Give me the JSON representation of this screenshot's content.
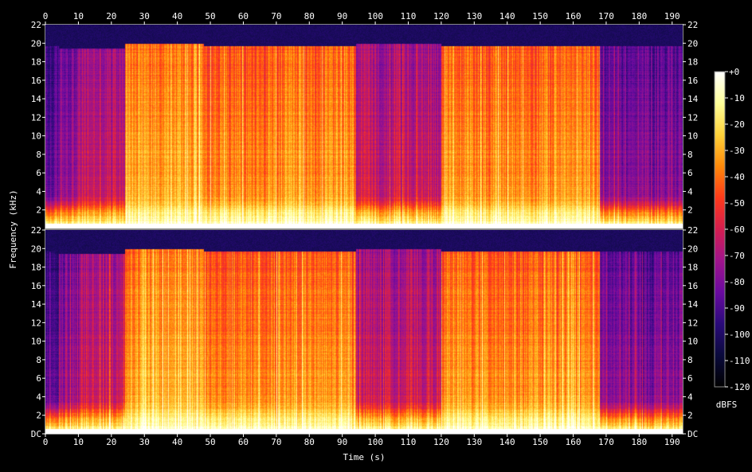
{
  "chart_data": {
    "type": "heatmap",
    "xlabel": "Time (s)",
    "ylabel": "Frequency (kHz)",
    "x_ticks": [
      0,
      10,
      20,
      30,
      40,
      50,
      60,
      70,
      80,
      90,
      100,
      110,
      120,
      130,
      140,
      150,
      160,
      170,
      180,
      190
    ],
    "xlim": [
      0,
      193.2
    ],
    "channels": [
      {
        "ylim": [
          0,
          22
        ],
        "y_ticks": [
          "2",
          "4",
          "6",
          "8",
          "10",
          "12",
          "14",
          "16",
          "18",
          "20",
          "22"
        ]
      },
      {
        "ylim": [
          0,
          22
        ],
        "y_ticks": [
          "DC",
          "2",
          "4",
          "6",
          "8",
          "10",
          "12",
          "14",
          "16",
          "18",
          "20",
          "22"
        ]
      }
    ],
    "colorbar": {
      "label": "dBFS",
      "range": [
        -120,
        0
      ],
      "ticks": [
        "+0",
        "-10",
        "-20",
        "-30",
        "-40",
        "-50",
        "-60",
        "-70",
        "-80",
        "-90",
        "-100",
        "-110",
        "-120"
      ],
      "colors": [
        "#000000",
        "#0a0a3c",
        "#2a0a7a",
        "#6a0aa0",
        "#a0148c",
        "#d41e50",
        "#ff3a1a",
        "#ff8a0a",
        "#ffd23a",
        "#ffff9a",
        "#ffffff"
      ]
    },
    "segments": [
      {
        "t": [
          0,
          4
        ],
        "intensity": 0.32,
        "cutoff_khz": 19.7
      },
      {
        "t": [
          4,
          10
        ],
        "intensity": 0.42,
        "cutoff_khz": 19.5
      },
      {
        "t": [
          10,
          24
        ],
        "intensity": 0.5,
        "cutoff_khz": 19.5
      },
      {
        "t": [
          24,
          48
        ],
        "intensity": 0.78,
        "cutoff_khz": 20.0
      },
      {
        "t": [
          48,
          70
        ],
        "intensity": 0.72,
        "cutoff_khz": 19.7
      },
      {
        "t": [
          70,
          94
        ],
        "intensity": 0.74,
        "cutoff_khz": 19.7
      },
      {
        "t": [
          94,
          120
        ],
        "intensity": 0.5,
        "cutoff_khz": 20.0
      },
      {
        "t": [
          120,
          168
        ],
        "intensity": 0.74,
        "cutoff_khz": 19.7
      },
      {
        "t": [
          168,
          193.2
        ],
        "intensity": 0.38,
        "cutoff_khz": 19.7
      }
    ]
  }
}
